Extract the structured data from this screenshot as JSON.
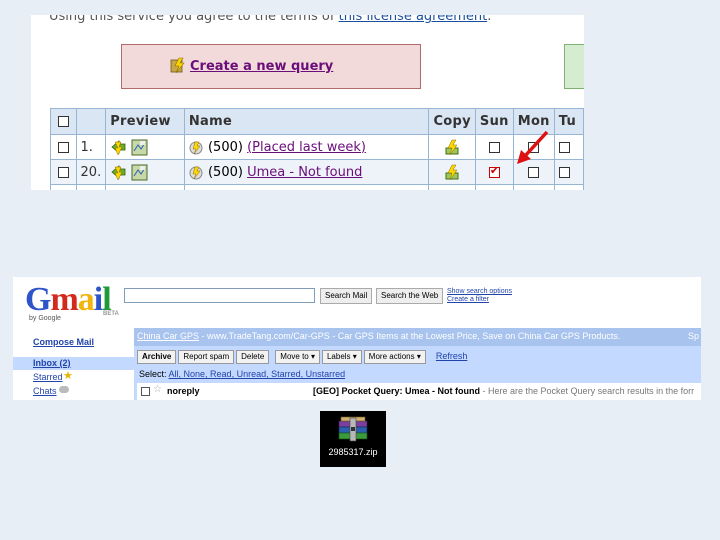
{
  "geocaching": {
    "license_prefix": "Using this service you agree to the terms of ",
    "license_link": "this license agreement",
    "license_suffix": ".",
    "create_query_label": "Create a new query",
    "headers": {
      "preview": "Preview",
      "name": "Name",
      "copy": "Copy",
      "sun": "Sun",
      "mon": "Mon",
      "tue": "Tu"
    },
    "rows": [
      {
        "index": "1.",
        "count": "(500)",
        "name": "(Placed last week)",
        "sun_checked": false,
        "mon_checked": false
      },
      {
        "index": "20.",
        "count": "(500)",
        "name": "Umea - Not found",
        "sun_checked": true,
        "mon_checked": false
      }
    ],
    "arrow_color": "#dd1111"
  },
  "gmail": {
    "logo_text": "Gmail",
    "logo_by": "by Google",
    "logo_beta": "BETA",
    "search_mail_button": "Search Mail",
    "search_web_button": "Search the Web",
    "show_search_options": "Show search options",
    "create_filter": "Create a filter",
    "compose": "Compose Mail",
    "inbox": "Inbox (2)",
    "starred": "Starred",
    "chats": "Chats",
    "ad_link": "China Car GPS",
    "ad_text": " - www.TradeTang.com/Car-GPS - Car GPS Items at the Lowest Price, Save on China Car GPS Products.",
    "ad_sponsored": "Sp",
    "toolbar": [
      "Archive",
      "Report spam",
      "Delete",
      "Move to ▾",
      "Labels ▾",
      "More actions ▾"
    ],
    "refresh": "Refresh",
    "select_label": "Select: ",
    "select_options": "All, None, Read, Unread, Starred, Unstarred",
    "email_sender": "noreply",
    "email_subject": "[GEO] Pocket Query: Umea - Not found",
    "email_snippet": " - Here are the Pocket Query search results in the forr"
  },
  "zip_file": {
    "filename": "2985317.zip"
  }
}
